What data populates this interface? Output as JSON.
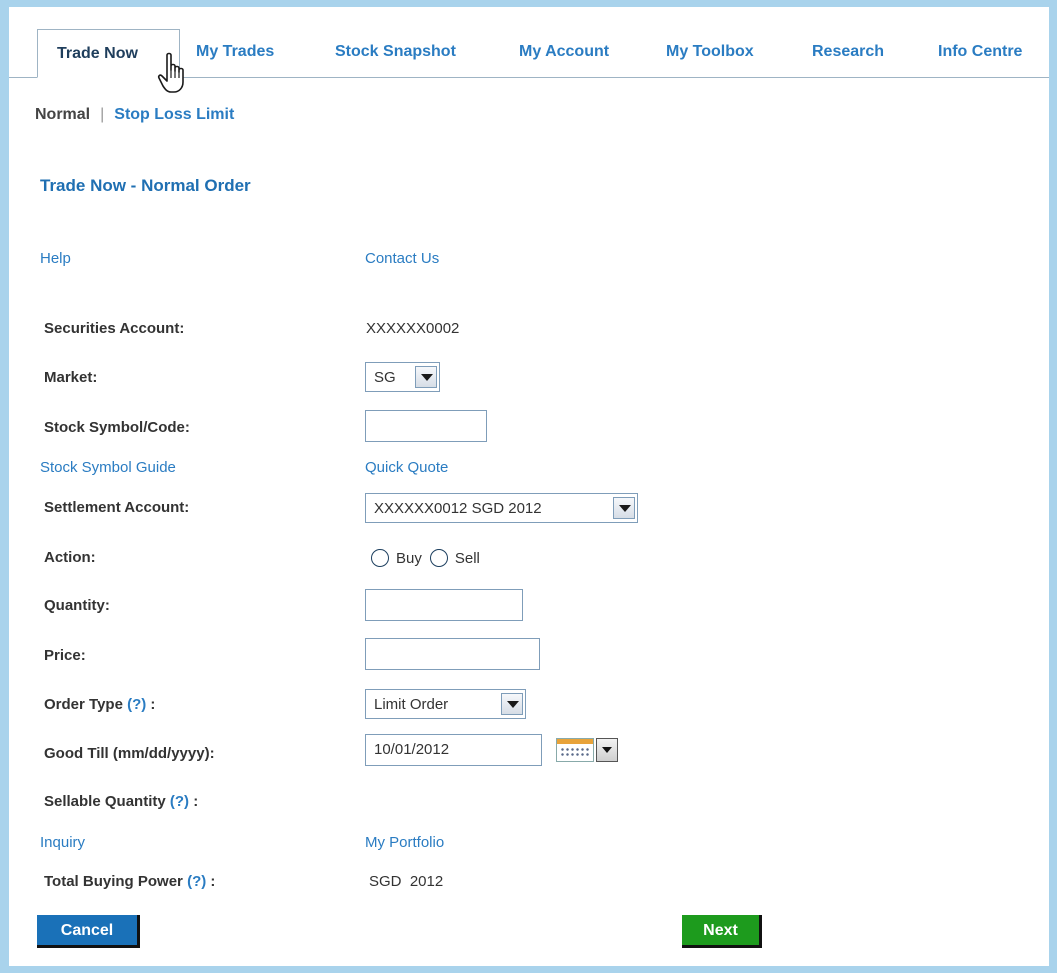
{
  "tabs": [
    {
      "label": "Trade Now"
    },
    {
      "label": "My Trades"
    },
    {
      "label": "Stock Snapshot"
    },
    {
      "label": "My Account"
    },
    {
      "label": "My Toolbox"
    },
    {
      "label": "Research"
    },
    {
      "label": "Info Centre"
    }
  ],
  "subnav": {
    "current": "Normal",
    "separator": "|",
    "link": "Stop Loss Limit"
  },
  "heading": "Trade Now - Normal Order",
  "top_links": {
    "help": "Help",
    "contact": "Contact Us"
  },
  "form": {
    "securities_account": {
      "label": "Securities Account:",
      "value": "XXXXXX0002"
    },
    "market": {
      "label": "Market:",
      "value": "SG"
    },
    "stock_symbol": {
      "label": "Stock Symbol/Code:",
      "value": ""
    },
    "stock_links": {
      "guide": "Stock Symbol Guide",
      "quote": "Quick Quote"
    },
    "settlement_account": {
      "label": "Settlement Account:",
      "value": "XXXXXX0012 SGD 2012"
    },
    "action": {
      "label": "Action:",
      "buy": "Buy",
      "sell": "Sell"
    },
    "quantity": {
      "label": "Quantity:",
      "value": ""
    },
    "price": {
      "label": "Price:",
      "value": ""
    },
    "order_type": {
      "label": "Order Type",
      "help": "(?)",
      "suffix": ":",
      "value": "Limit Order"
    },
    "good_till": {
      "label": "Good Till (mm/dd/yyyy):",
      "value": "10/01/2012"
    },
    "sellable_quantity": {
      "label": "Sellable Quantity",
      "help": "(?)",
      "suffix": ":"
    },
    "inquiry_links": {
      "inquiry": "Inquiry",
      "portfolio": "My Portfolio"
    },
    "total_buying_power": {
      "label": "Total Buying Power",
      "help": "(?)",
      "suffix": ":",
      "value": "SGD  2012"
    }
  },
  "buttons": {
    "cancel": "Cancel",
    "next": "Next"
  },
  "icons": {
    "cursor": "hand-pointer-icon",
    "calendar": "calendar-icon",
    "dropdown": "chevron-down-icon"
  },
  "colors": {
    "link": "#2a7cc2",
    "frame": "#a9d3ec",
    "cancel": "#1a71b8",
    "next": "#1d9b1d"
  }
}
